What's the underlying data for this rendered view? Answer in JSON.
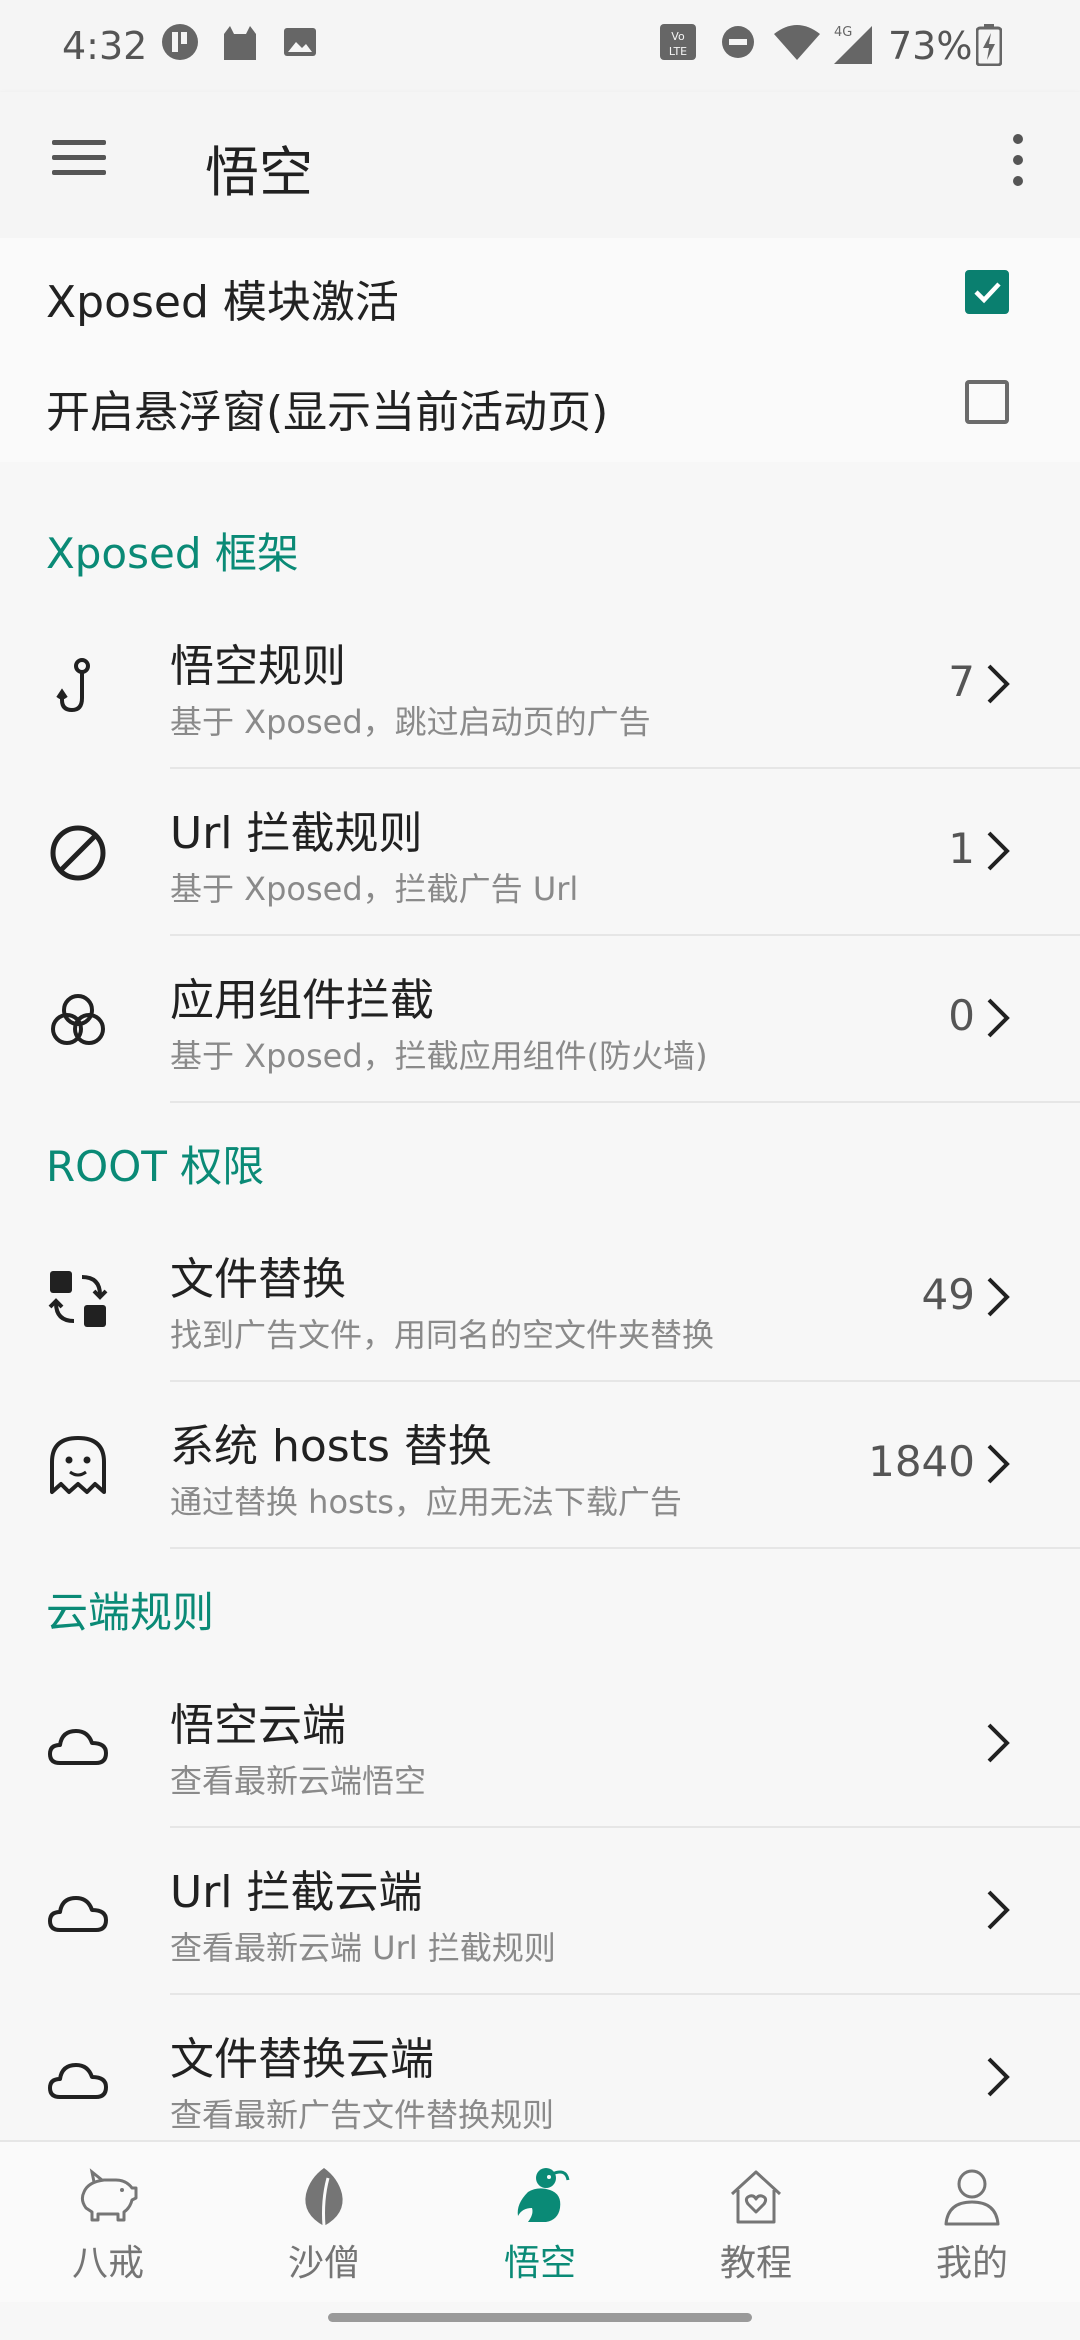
{
  "status_bar": {
    "time": "4:32",
    "battery": "73%",
    "network": "4G",
    "volte": "VoLTE"
  },
  "app_bar": {
    "title": "悟空"
  },
  "switches": [
    {
      "label": "Xposed 模块激活",
      "checked": true
    },
    {
      "label": "开启悬浮窗(显示当前活动页)",
      "checked": false
    }
  ],
  "sections": [
    {
      "header": "Xposed 框架",
      "items": [
        {
          "title": "悟空规则",
          "subtitle": "基于 Xposed，跳过启动页的广告",
          "count": "7",
          "icon": "hook-icon"
        },
        {
          "title": "Url 拦截规则",
          "subtitle": "基于 Xposed，拦截广告 Url",
          "count": "1",
          "icon": "block-icon"
        },
        {
          "title": "应用组件拦截",
          "subtitle": "基于 Xposed，拦截应用组件(防火墙)",
          "count": "0",
          "icon": "circles-icon"
        }
      ]
    },
    {
      "header": "ROOT 权限",
      "items": [
        {
          "title": "文件替换",
          "subtitle": "找到广告文件，用同名的空文件夹替换",
          "count": "49",
          "icon": "swap-icon"
        },
        {
          "title": "系统 hosts 替换",
          "subtitle": "通过替换 hosts，应用无法下载广告",
          "count": "1840",
          "icon": "ghost-icon"
        }
      ]
    },
    {
      "header": "云端规则",
      "items": [
        {
          "title": "悟空云端",
          "subtitle": "查看最新云端悟空",
          "count": "",
          "icon": "cloud-icon"
        },
        {
          "title": "Url 拦截云端",
          "subtitle": "查看最新云端 Url 拦截规则",
          "count": "",
          "icon": "cloud-icon"
        },
        {
          "title": "文件替换云端",
          "subtitle": "查看最新广告文件替换规则",
          "count": "",
          "icon": "cloud-icon"
        }
      ]
    }
  ],
  "bottom_nav": [
    {
      "label": "八戒",
      "icon": "pig-icon",
      "active": false
    },
    {
      "label": "沙僧",
      "icon": "leaf-icon",
      "active": false
    },
    {
      "label": "悟空",
      "icon": "monkey-icon",
      "active": true
    },
    {
      "label": "教程",
      "icon": "house-heart-icon",
      "active": false
    },
    {
      "label": "我的",
      "icon": "person-icon",
      "active": false
    }
  ],
  "colors": {
    "accent": "#0a8a76",
    "checkbox": "#0a7f6f"
  }
}
